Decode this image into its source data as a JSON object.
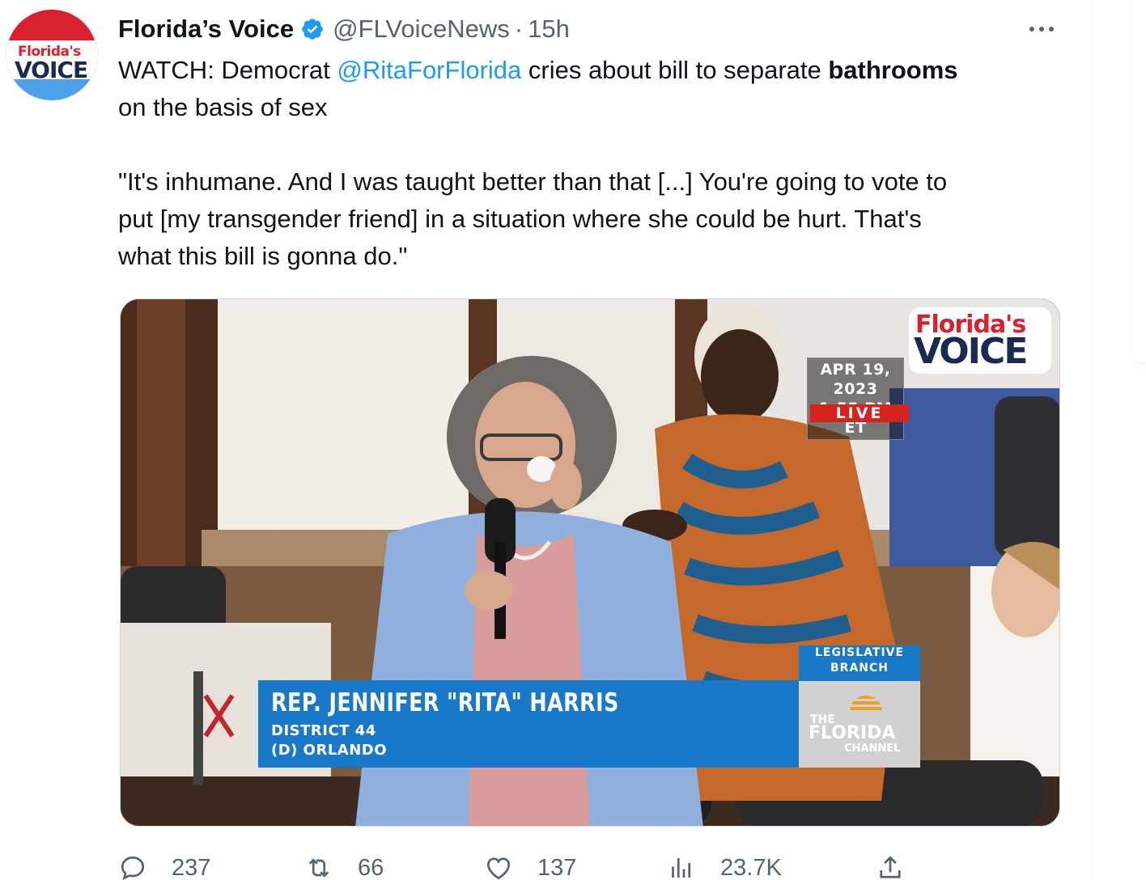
{
  "tweet": {
    "avatar_text": [
      "Florida's",
      "VOICE"
    ],
    "display_name": "Florida’s Voice",
    "handle": "@FLVoiceNews",
    "separator": "·",
    "time": "15h",
    "text": {
      "line1_prefix": "WATCH: Democrat ",
      "mention": "@RitaForFlorida",
      "line1_middle": " cries about bill to separate ",
      "line1_bold": "bathrooms",
      "line2": "on the basis of sex",
      "quote_line1": "\"It's inhumane. And I was taught better than that [...] You're going to vote to",
      "quote_line2": "put [my transgender friend] in a situation where she could be hurt. That's",
      "quote_line3": "what this bill is gonna do.\""
    }
  },
  "media": {
    "logo_line1": "Florida's",
    "logo_line2": "VOICE",
    "date": "APR 19, 2023",
    "clock": "1:55 PM ET",
    "live": "LIVE",
    "lower_third": {
      "name": "REP. JENNIFER \"RITA\" HARRIS",
      "district": "DISTRICT 44",
      "city": "(D) ORLANDO"
    },
    "branch_line1": "LEGISLATIVE",
    "branch_line2": "BRANCH",
    "channel_line1": "THE",
    "channel_line2": "FLORIDA",
    "channel_line3": "CHANNEL"
  },
  "actions": {
    "replies": "237",
    "retweets": "66",
    "likes": "137",
    "views": "23.7K"
  },
  "colors": {
    "accent": "#1d9bf0",
    "secondary_text": "#536471",
    "lower_third_blue": "#1a78c9",
    "live_red": "#d6231e"
  },
  "icons": [
    "verified-badge-icon",
    "more-icon",
    "reply-icon",
    "retweet-icon",
    "like-icon",
    "views-icon",
    "share-icon"
  ]
}
